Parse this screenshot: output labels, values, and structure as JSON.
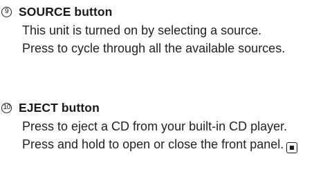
{
  "sections": [
    {
      "number": "9",
      "title": "SOURCE button",
      "lines": [
        "This unit is turned on by selecting a source.",
        "Press to cycle through all the available sources."
      ]
    },
    {
      "number": "10",
      "title": "EJECT button",
      "lines": [
        "Press to eject a CD from your built-in CD player.",
        "Press and hold to open or close the front panel."
      ]
    }
  ],
  "end_mark_icon": "end-of-section-icon"
}
